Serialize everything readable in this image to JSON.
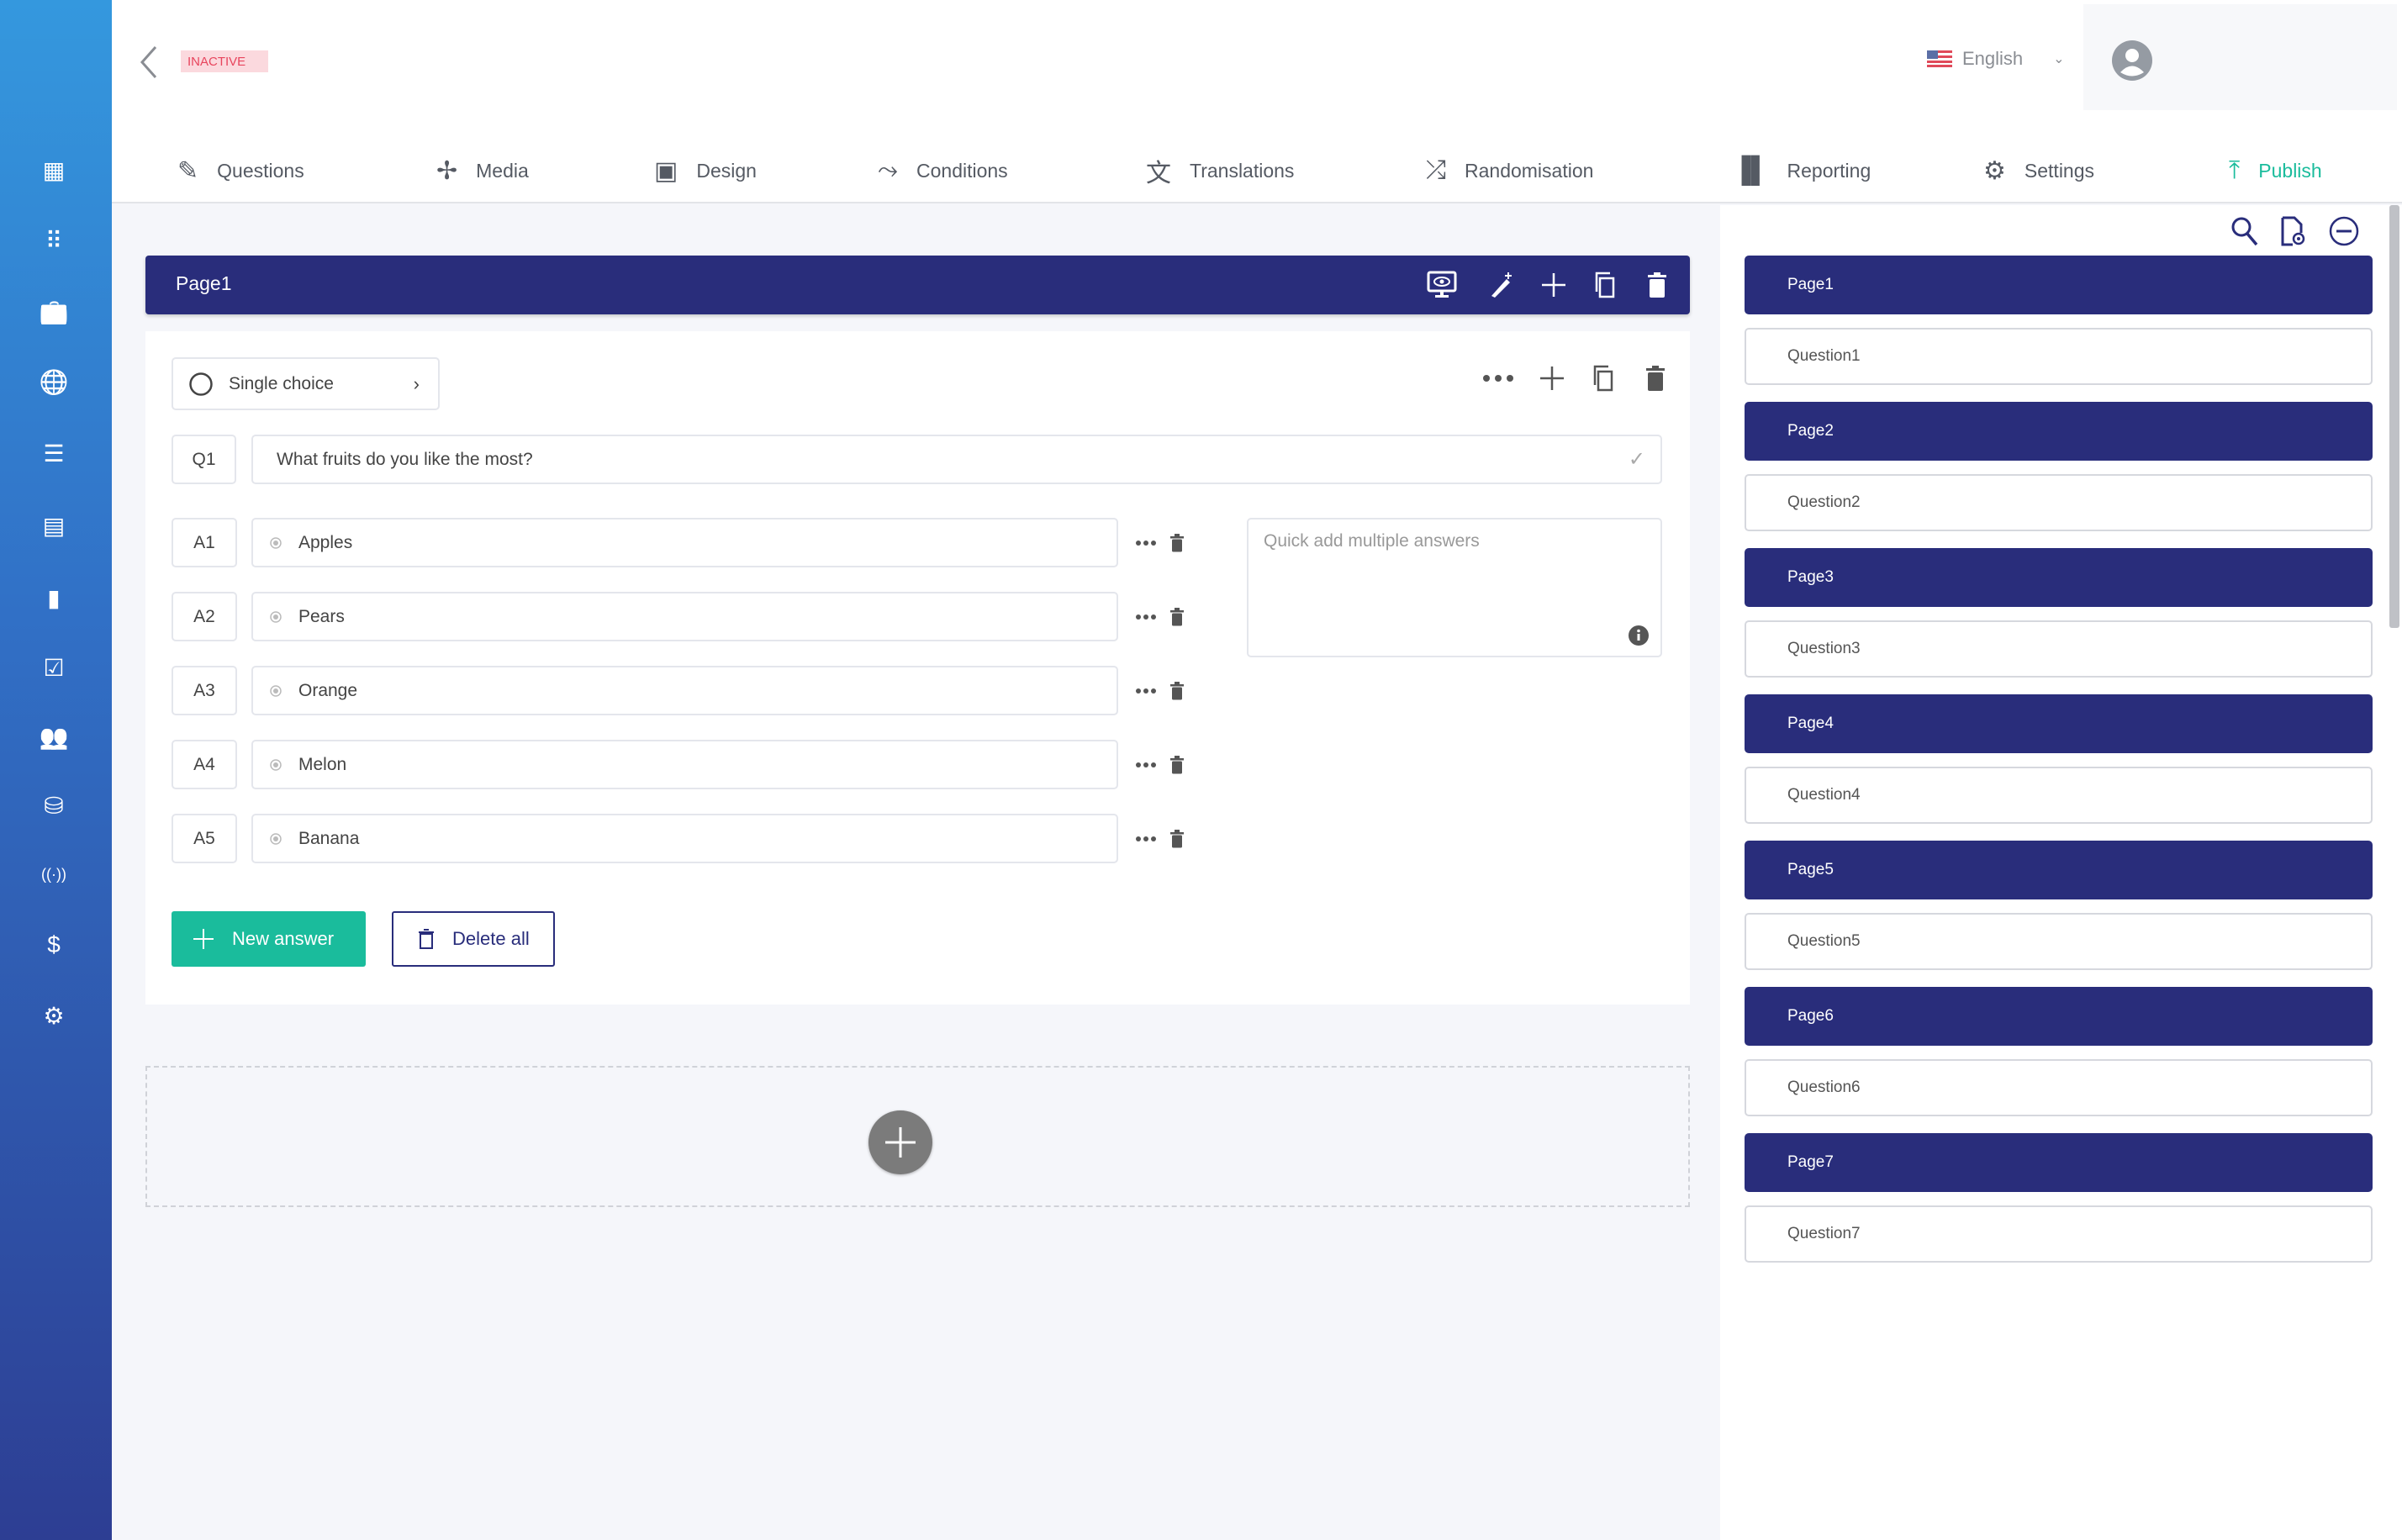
{
  "header": {
    "status_badge": "INACTIVE",
    "language": "English"
  },
  "sidebar": {
    "icons": [
      "dashboard-icon",
      "apps-grid-icon",
      "briefcase-icon",
      "globe-icon",
      "list-chart-icon",
      "feedback-icon",
      "analytics-icon",
      "checkbox-icon",
      "users-icon",
      "database-icon",
      "broadcast-icon",
      "billing-icon",
      "settings-icon"
    ]
  },
  "tabs": [
    {
      "label": "Questions",
      "icon": "pencil-icon"
    },
    {
      "label": "Media",
      "icon": "media-icon"
    },
    {
      "label": "Design",
      "icon": "design-icon"
    },
    {
      "label": "Conditions",
      "icon": "conditions-icon"
    },
    {
      "label": "Translations",
      "icon": "translate-icon"
    },
    {
      "label": "Randomisation",
      "icon": "shuffle-icon"
    },
    {
      "label": "Reporting",
      "icon": "bar-chart-icon"
    },
    {
      "label": "Settings",
      "icon": "gear-icon"
    },
    {
      "label": "Publish",
      "icon": "upload-icon",
      "active": true
    }
  ],
  "colors": {
    "primary": "#292d7b",
    "accent": "#1abc9c",
    "inactive": "#e8455d"
  },
  "page": {
    "title": "Page1"
  },
  "question": {
    "type": "Single choice",
    "code": "Q1",
    "text": "What fruits do you like the most?"
  },
  "answers": [
    {
      "code": "A1",
      "text": "Apples"
    },
    {
      "code": "A2",
      "text": "Pears"
    },
    {
      "code": "A3",
      "text": "Orange"
    },
    {
      "code": "A4",
      "text": "Melon"
    },
    {
      "code": "A5",
      "text": "Banana"
    }
  ],
  "quick_add": {
    "placeholder": "Quick add multiple answers"
  },
  "buttons": {
    "new_answer": "New answer",
    "delete_all": "Delete all"
  },
  "outline": [
    {
      "page": "Page1",
      "question": "Question1"
    },
    {
      "page": "Page2",
      "question": "Question2"
    },
    {
      "page": "Page3",
      "question": "Question3"
    },
    {
      "page": "Page4",
      "question": "Question4"
    },
    {
      "page": "Page5",
      "question": "Question5"
    },
    {
      "page": "Page6",
      "question": "Question6"
    },
    {
      "page": "Page7",
      "question": "Question7"
    }
  ]
}
